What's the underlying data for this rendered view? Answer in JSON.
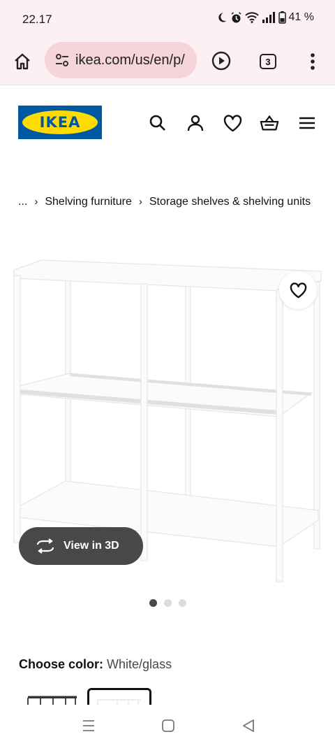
{
  "status_bar": {
    "time": "22.17",
    "battery": "41 %",
    "icons": [
      "moon-icon",
      "alarm-icon",
      "wifi-icon",
      "signal-icon",
      "battery-icon"
    ]
  },
  "browser": {
    "url": "ikea.com/us/en/p/",
    "tab_count": "3",
    "icons": [
      "home-icon",
      "site-settings-icon",
      "play-icon",
      "tabs-icon",
      "more-vert-icon"
    ]
  },
  "header": {
    "logo_text": "IKEA",
    "brand_colors": {
      "blue": "#0058a3",
      "yellow": "#ffdb00"
    },
    "icons": [
      "search-icon",
      "account-icon",
      "favorite-icon",
      "cart-icon",
      "hamburger-menu-icon"
    ]
  },
  "breadcrumb": {
    "items": [
      "...",
      "Shelving furniture",
      "Storage shelves & shelving units"
    ]
  },
  "product": {
    "view_3d_label": "View in 3D",
    "gallery_dots": 3,
    "active_dot": 0,
    "color_label": "Choose color:",
    "color_value": "White/glass",
    "swatches": [
      {
        "name": "black-brown",
        "selected": false
      },
      {
        "name": "white-glass",
        "selected": true
      }
    ]
  },
  "system_nav": {
    "icons": [
      "recent-apps-icon",
      "home-nav-icon",
      "back-icon"
    ]
  }
}
